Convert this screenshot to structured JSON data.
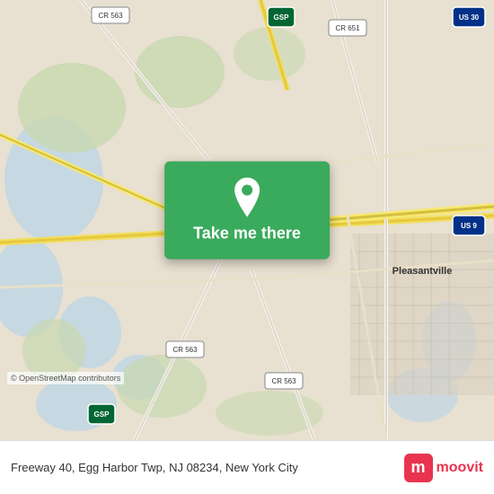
{
  "map": {
    "alt": "Map of Egg Harbor Township, NJ area",
    "center_lat": 39.38,
    "center_lng": -74.62
  },
  "button": {
    "label": "Take me there"
  },
  "bottom_bar": {
    "address": "Freeway 40, Egg Harbor Twp, NJ 08234, New York City"
  },
  "attribution": {
    "text": "© OpenStreetMap contributors"
  },
  "moovit": {
    "label": "moovit",
    "icon_letter": "m"
  },
  "roads": {
    "cr563_label": "CR 563",
    "cr651_label": "CR 651",
    "gsp_label": "GSP",
    "us30_label": "US 30",
    "us9_label": "US 9",
    "pleasantville_label": "Pleasantville"
  }
}
